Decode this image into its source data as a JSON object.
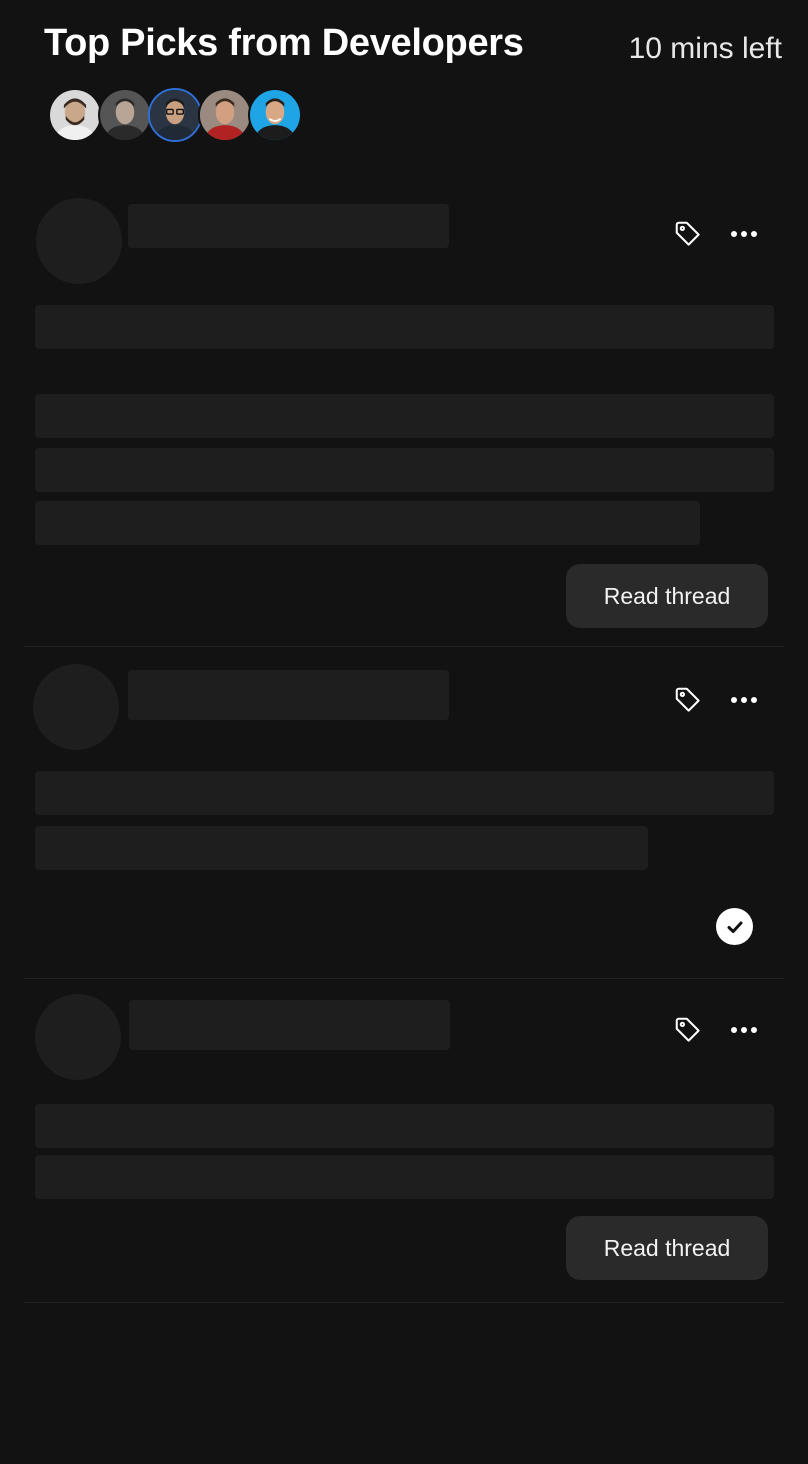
{
  "header": {
    "title": "Top Picks from Developers",
    "time_left": "10 mins left"
  },
  "avatars": [
    {
      "name": "avatar-1",
      "bg": "#d9d9d9",
      "skin": "#c9a78a",
      "hair": "#3a2a20",
      "shirt": "#f0f0f0"
    },
    {
      "name": "avatar-2",
      "bg": "#555555",
      "skin": "#b8a595",
      "hair": "#2b2b2b",
      "shirt": "#2a2a2a"
    },
    {
      "name": "avatar-3",
      "bg": "#2a3442",
      "skin": "#c8a080",
      "hair": "#1e1e1e",
      "shirt": "#1f2a36",
      "ring": "#2f6fd6"
    },
    {
      "name": "avatar-4",
      "bg": "#9a8a80",
      "skin": "#d2a080",
      "hair": "#3a2a1e",
      "shirt": "#b22222"
    },
    {
      "name": "avatar-5",
      "bg": "#1fa5e6",
      "skin": "#d8a884",
      "hair": "#2a1f18",
      "shirt": "#1c1c1c"
    }
  ],
  "cards": [
    {
      "read_button_label": "Read thread"
    },
    {
      "completed": true
    },
    {
      "read_button_label": "Read thread"
    }
  ],
  "colors": {
    "background": "#121212",
    "skeleton": "#1e1e1e",
    "button_bg": "#2a2a2a",
    "divider": "#232323"
  },
  "icons": {
    "tag": "tag-icon",
    "more": "more-options-icon",
    "check": "check-icon"
  }
}
